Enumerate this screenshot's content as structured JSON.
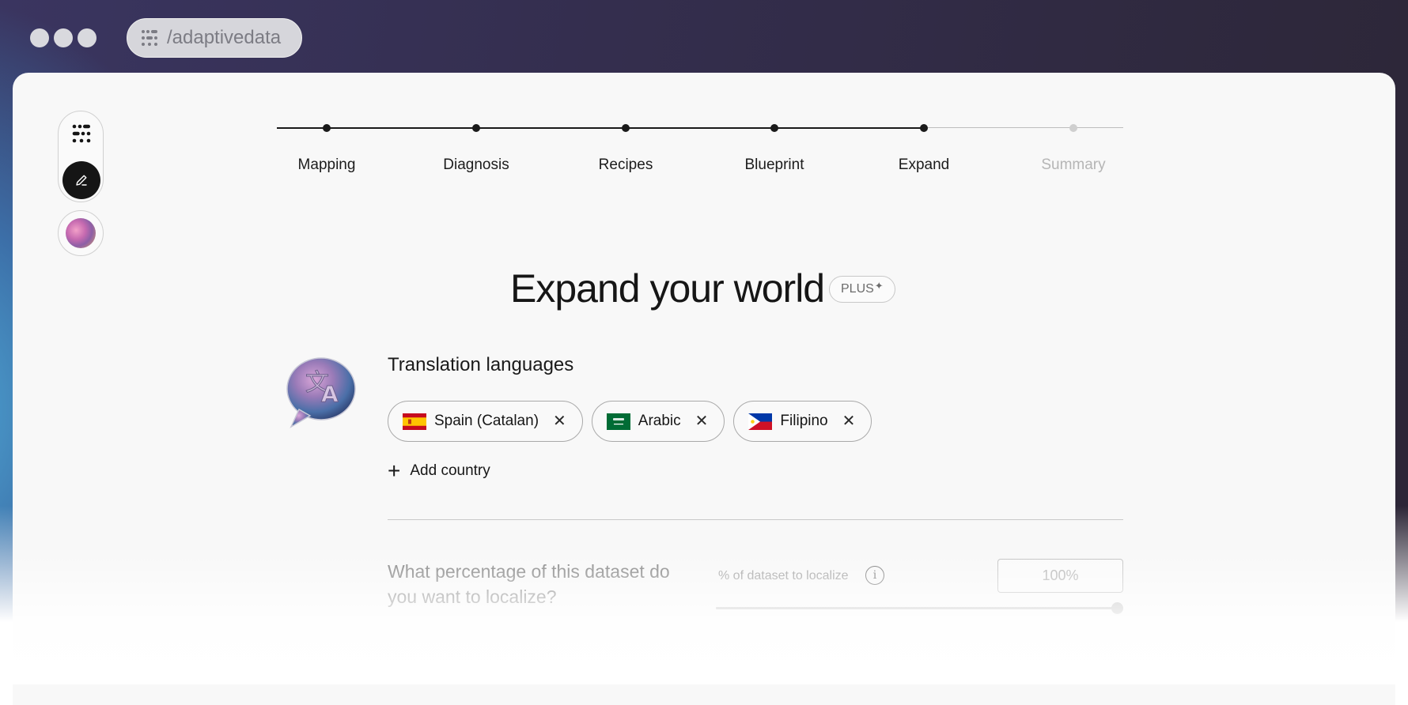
{
  "browser": {
    "url_text": "/adaptivedata"
  },
  "stepper": {
    "steps": [
      {
        "label": "Mapping",
        "status": "done"
      },
      {
        "label": "Diagnosis",
        "status": "done"
      },
      {
        "label": "Recipes",
        "status": "done"
      },
      {
        "label": "Blueprint",
        "status": "done"
      },
      {
        "label": "Expand",
        "status": "current"
      },
      {
        "label": "Summary",
        "status": "pending"
      }
    ]
  },
  "main": {
    "heading": "Expand your world",
    "badge_label": "PLUS",
    "badge_symbol": "✦"
  },
  "translation": {
    "title": "Translation languages",
    "languages": [
      {
        "label": "Spain (Catalan)",
        "flag": "spain-flag"
      },
      {
        "label": "Arabic",
        "flag": "saudi-arabia-flag"
      },
      {
        "label": "Filipino",
        "flag": "philippines-flag"
      }
    ],
    "add_label": "Add country"
  },
  "localize": {
    "question": "What percentage of this dataset do you want to localize?",
    "slider_label": "% of dataset to localize",
    "input_value": "100%",
    "slider_value": 1.0
  },
  "colors": {
    "accent_dark": "#151515",
    "muted_text": "#8a8a8a"
  }
}
